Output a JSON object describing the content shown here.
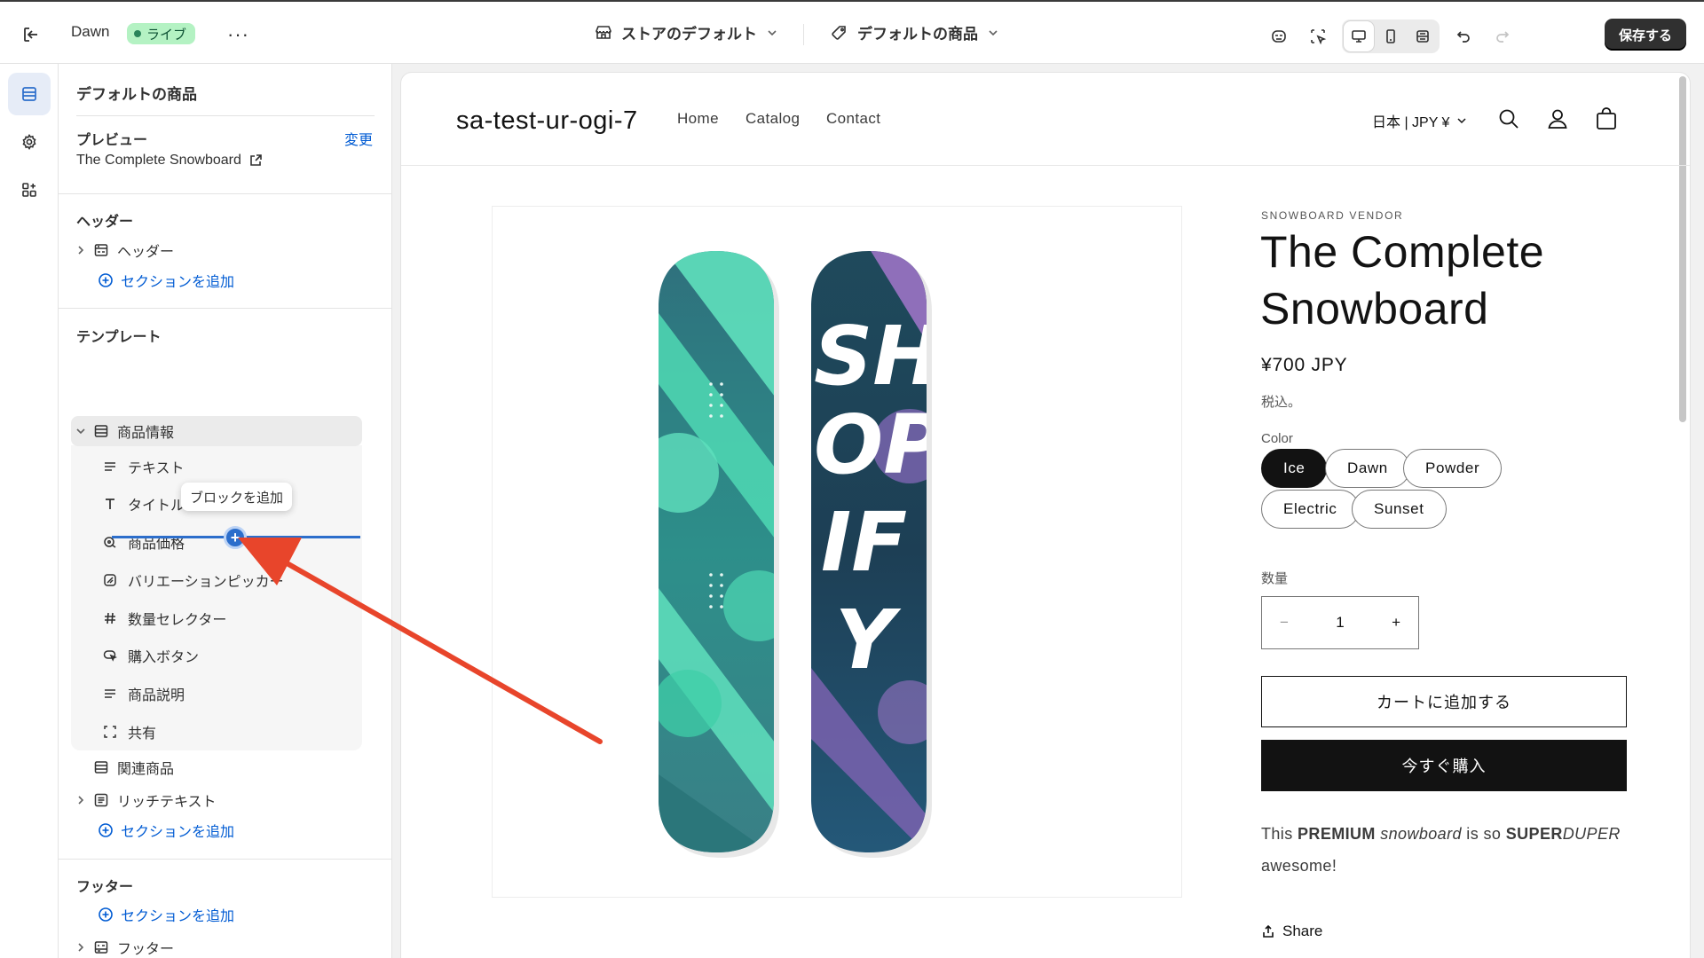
{
  "topbar": {
    "theme_name": "Dawn",
    "status": "ライブ",
    "more": "···",
    "store_selector": "ストアのデフォルト",
    "template_selector": "デフォルトの商品",
    "save_label": "保存する"
  },
  "sidebar": {
    "title": "デフォルトの商品",
    "preview_heading": "プレビュー",
    "preview_change": "変更",
    "preview_product": "The Complete Snowboard",
    "header_heading": "ヘッダー",
    "header_item": "ヘッダー",
    "add_section": "セクションを追加",
    "template_heading": "テンプレート",
    "main_section": "商品情報",
    "blocks": [
      {
        "label": "テキスト",
        "icon": "text-lines-icon"
      },
      {
        "label": "タイトル",
        "icon": "title-t-icon"
      },
      {
        "label": "商品価格",
        "icon": "price-tag-icon"
      },
      {
        "label": "バリエーションピッカー",
        "icon": "variant-picker-icon"
      },
      {
        "label": "数量セレクター",
        "icon": "hash-icon"
      },
      {
        "label": "購入ボタン",
        "icon": "buy-button-icon"
      },
      {
        "label": "商品説明",
        "icon": "text-lines-icon"
      },
      {
        "label": "共有",
        "icon": "share-frame-icon"
      }
    ],
    "related_products": "関連商品",
    "rich_text": "リッチテキスト",
    "footer_heading": "フッター",
    "footer_item": "フッター",
    "tooltip": "ブロックを追加"
  },
  "store": {
    "logo": "sa-test-ur-ogi-7",
    "nav": [
      "Home",
      "Catalog",
      "Contact"
    ],
    "locale": "日本 | JPY ¥",
    "vendor": "SNOWBOARD VENDOR",
    "product_title": "The Complete Snowboard",
    "price": "¥700 JPY",
    "tax_note": "税込。",
    "option_label": "Color",
    "colors": [
      "Ice",
      "Dawn",
      "Powder",
      "Electric",
      "Sunset"
    ],
    "selected_color": "Ice",
    "quantity_label": "数量",
    "quantity_value": "1",
    "qty_minus": "−",
    "qty_plus": "+",
    "add_to_cart": "カートに追加する",
    "buy_now": "今すぐ購入",
    "description": {
      "p1": "This ",
      "b1": "PREMIUM",
      "p2": " ",
      "i1": "snowboard",
      "p3": " is so ",
      "b2": "SUPER",
      "i2": "DUPER",
      "p4": " awesome!"
    },
    "share": "Share",
    "board_graphic_text": "SHOPIFY"
  },
  "colors": {
    "accent_blue": "#2c6ecb",
    "annotation_arrow": "#e8452b",
    "live_badge_bg": "#b4f2c3",
    "board_teal": "#4fd9b4",
    "board_purple": "#9b73c4"
  }
}
